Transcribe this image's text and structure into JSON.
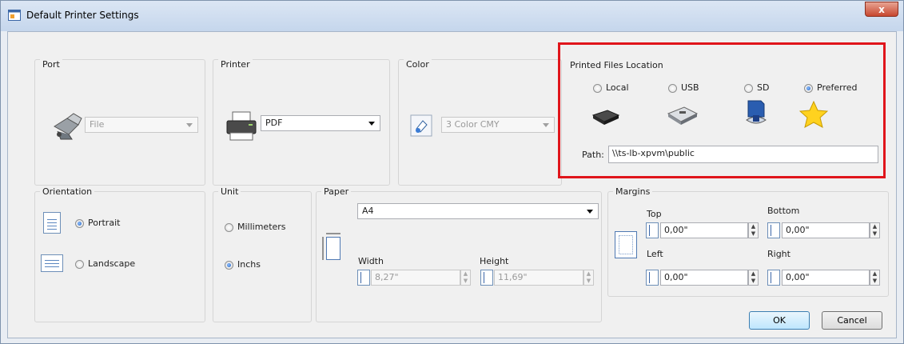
{
  "window": {
    "title": "Default Printer Settings",
    "close_label": "x"
  },
  "port": {
    "label": "Port",
    "selected": "File"
  },
  "printer": {
    "label": "Printer",
    "selected": "PDF"
  },
  "color": {
    "label": "Color",
    "selected": "3 Color CMY"
  },
  "location": {
    "label": "Printed Files Location",
    "options": [
      {
        "label": "Local",
        "checked": false
      },
      {
        "label": "USB",
        "checked": false
      },
      {
        "label": "SD",
        "checked": false
      },
      {
        "label": "Preferred",
        "checked": true
      }
    ],
    "path_label": "Path:",
    "path_value": "\\\\ts-lb-xpvm\\public"
  },
  "orientation": {
    "label": "Orientation",
    "portrait": "Portrait",
    "landscape": "Landscape",
    "selected": "Portrait"
  },
  "unit": {
    "label": "Unit",
    "millimeters": "Millimeters",
    "inchs": "Inchs",
    "selected": "Inchs"
  },
  "paper": {
    "label": "Paper",
    "selected": "A4",
    "width_label": "Width",
    "width_value": "8,27\"",
    "height_label": "Height",
    "height_value": "11,69\""
  },
  "margins": {
    "label": "Margins",
    "top_label": "Top",
    "top_value": "0,00\"",
    "bottom_label": "Bottom",
    "bottom_value": "0,00\"",
    "left_label": "Left",
    "left_value": "0,00\"",
    "right_label": "Right",
    "right_value": "0,00\""
  },
  "buttons": {
    "ok": "OK",
    "cancel": "Cancel"
  },
  "colors": {
    "highlight": "#e0151b",
    "titlebar": "#c5d6ec",
    "close": "#c7472f"
  }
}
